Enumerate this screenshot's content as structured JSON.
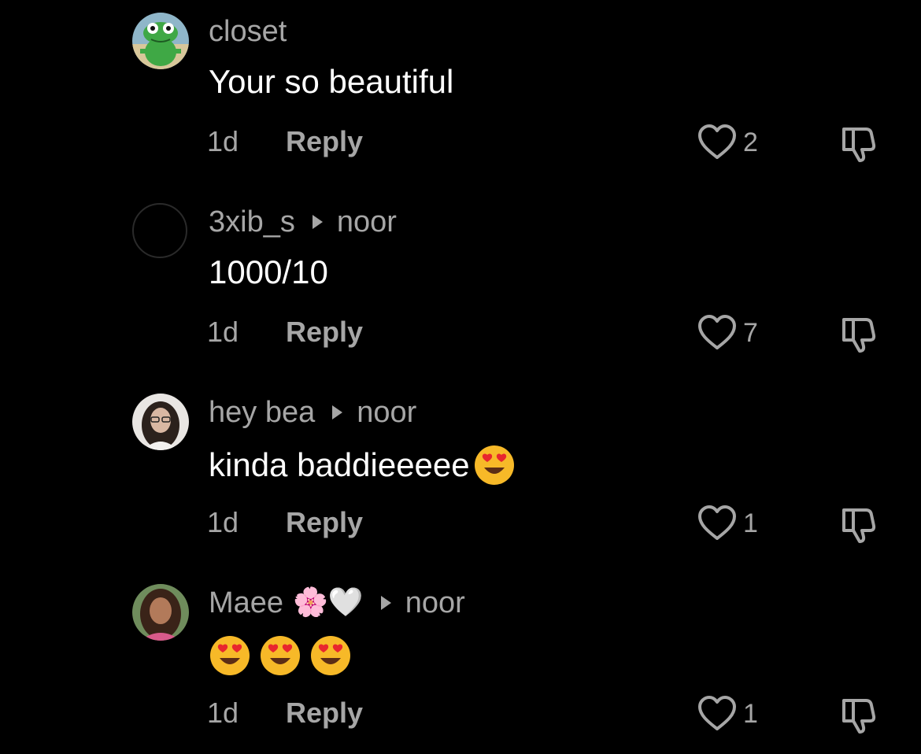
{
  "comments": [
    {
      "username": "closet",
      "reply_to": "",
      "text": "Your so beautiful",
      "time": "1d",
      "reply_label": "Reply",
      "likes": "2",
      "avatar": "frog-avatar"
    },
    {
      "username": "3xib_s",
      "reply_to": "noor",
      "text": "1000/10",
      "time": "1d",
      "reply_label": "Reply",
      "likes": "7",
      "avatar": "blank-avatar"
    },
    {
      "username": "hey bea",
      "reply_to": "noor",
      "text": "kinda baddieeeee",
      "time": "1d",
      "reply_label": "Reply",
      "likes": "1",
      "avatar": "photo-avatar"
    },
    {
      "username": "Maee",
      "username_emojis": "🌸🤍",
      "reply_to": "noor",
      "text": "",
      "time": "1d",
      "reply_label": "Reply",
      "likes": "1",
      "avatar": "photo-avatar"
    }
  ],
  "colors": {
    "background": "#000000",
    "primary_text": "#ffffff",
    "secondary_text": "#a6a6a6"
  },
  "icons": [
    "heart-icon",
    "dislike-icon",
    "reply-arrow-icon",
    "heart-eyes-emoji"
  ]
}
